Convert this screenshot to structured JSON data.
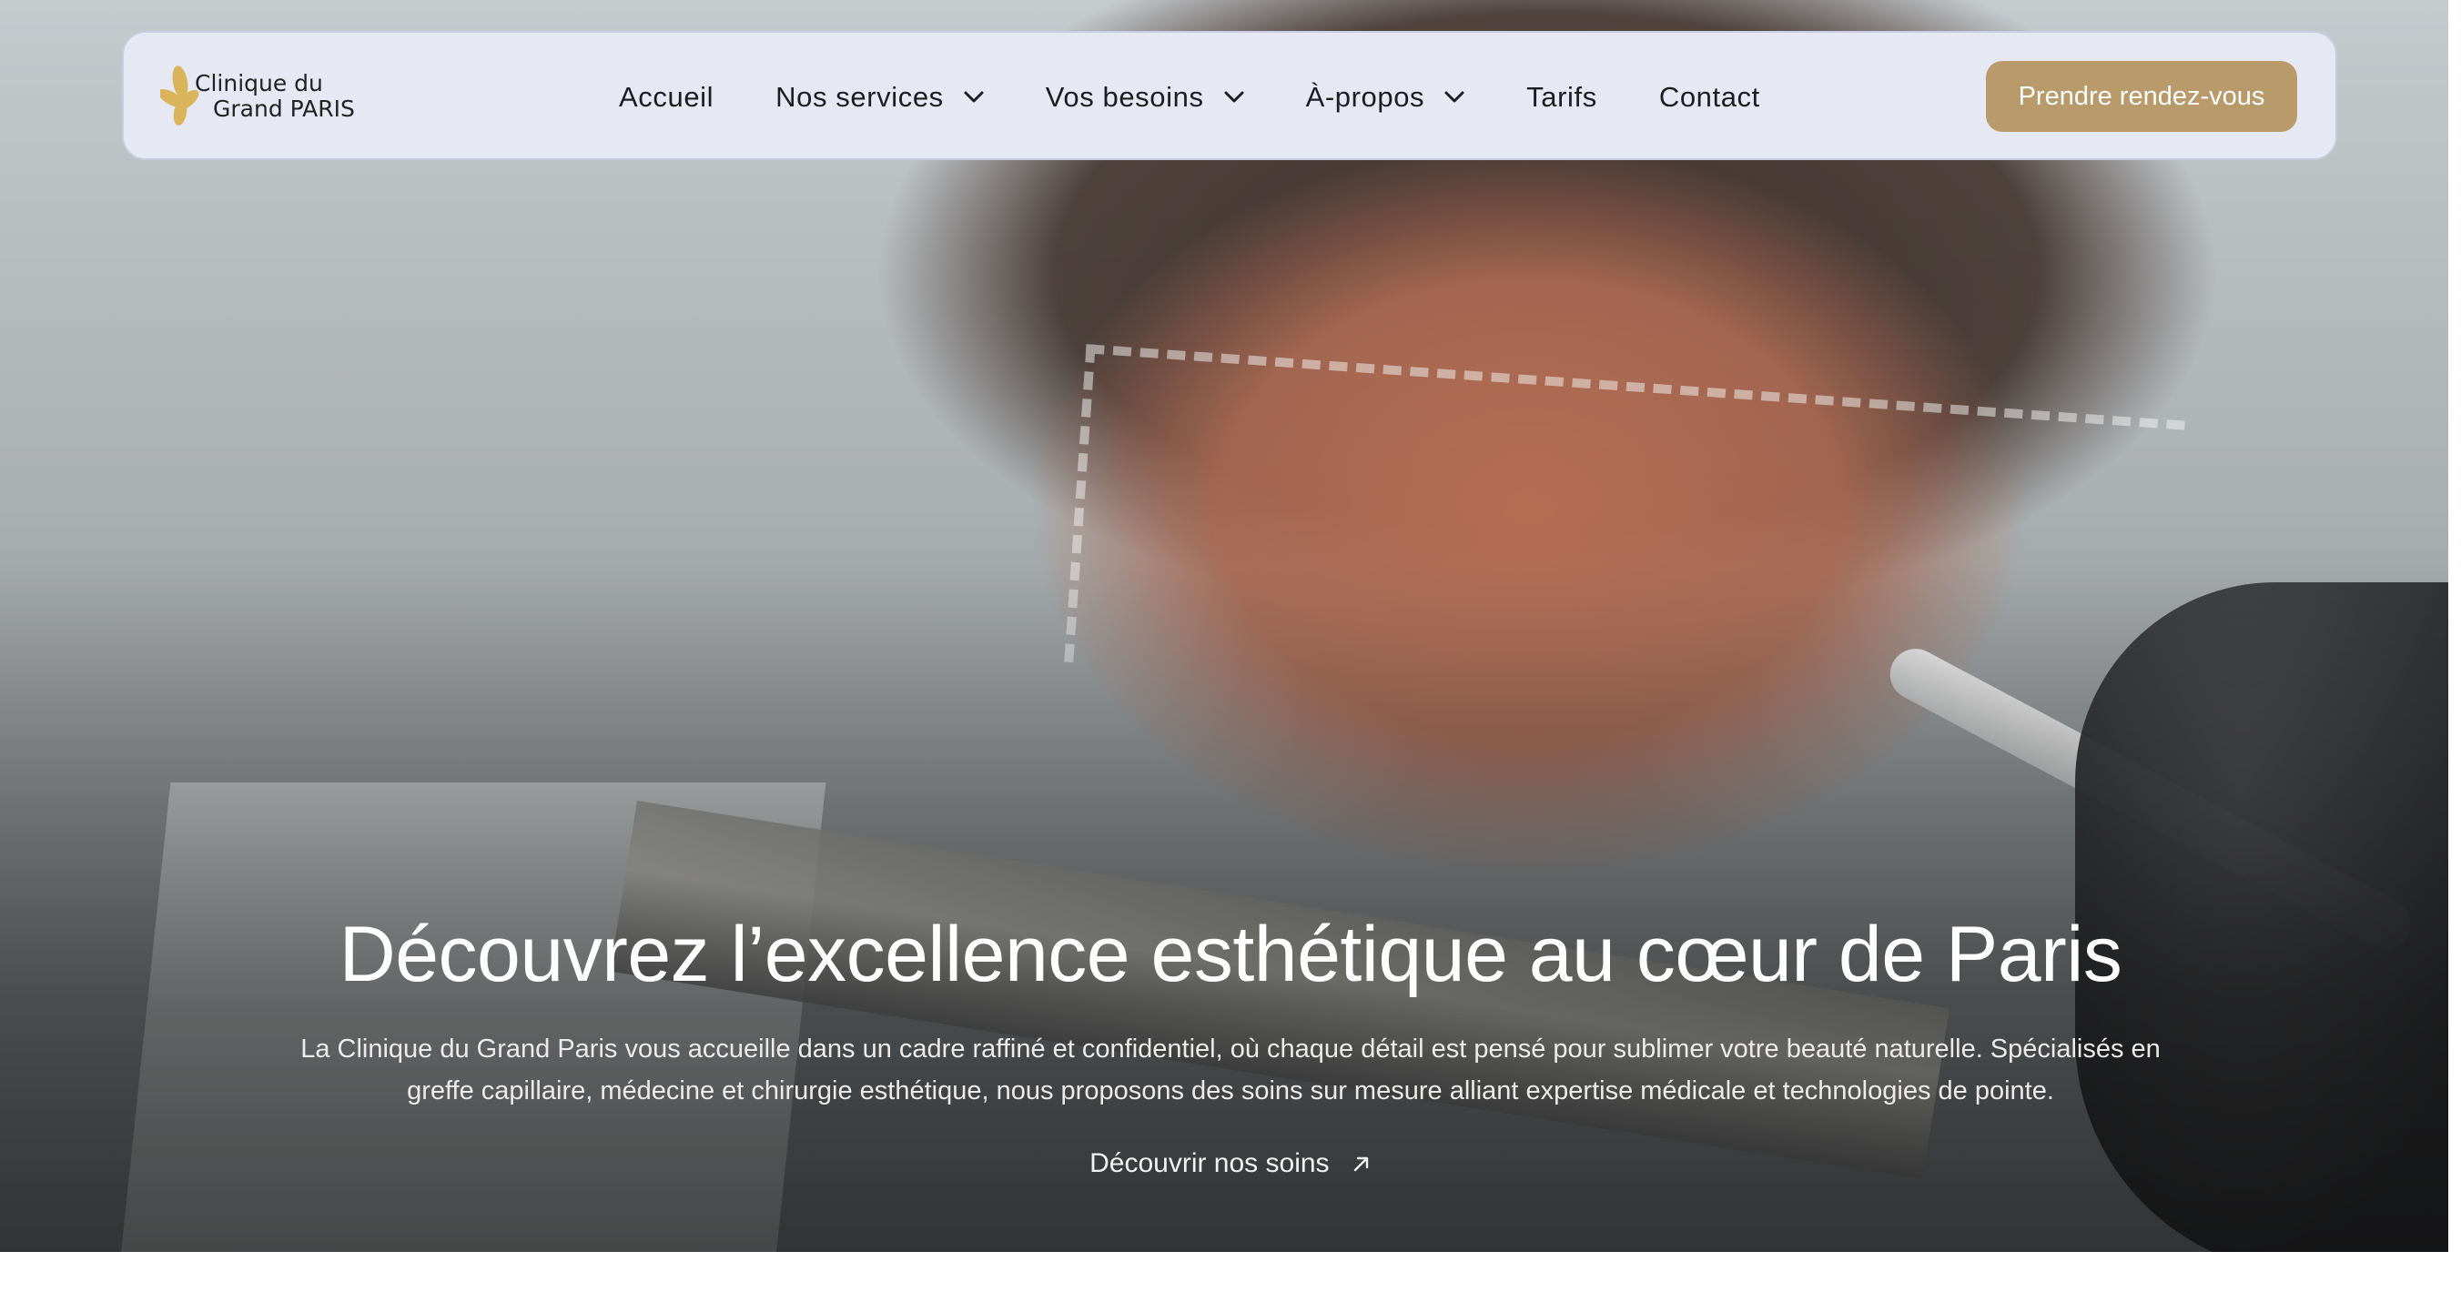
{
  "brand": {
    "logo_line1": "Clinique du",
    "logo_line2": "Grand PARIS",
    "accent_color": "#b89a6b",
    "logo_icon": "flower-icon"
  },
  "nav": {
    "items": [
      {
        "label": "Accueil",
        "has_dropdown": false
      },
      {
        "label": "Nos services",
        "has_dropdown": true
      },
      {
        "label": "Vos besoins",
        "has_dropdown": true
      },
      {
        "label": "À-propos",
        "has_dropdown": true
      },
      {
        "label": "Tarifs",
        "has_dropdown": false
      },
      {
        "label": "Contact",
        "has_dropdown": false
      }
    ],
    "cta_label": "Prendre rendez-vous"
  },
  "hero": {
    "title": "Découvrez l’excellence esthétique au cœur de Paris",
    "description_line1": "La Clinique du Grand Paris vous accueille dans un cadre raffiné et confidentiel, où chaque détail est pensé pour sublimer votre beauté naturelle. Spécialisés en",
    "description_line2": "greffe capillaire, médecine et chirurgie esthétique, nous proposons des soins sur mesure alliant expertise médicale et technologies de pointe.",
    "link_label": "Découvrir nos soins",
    "link_icon": "arrow-up-right-icon"
  }
}
